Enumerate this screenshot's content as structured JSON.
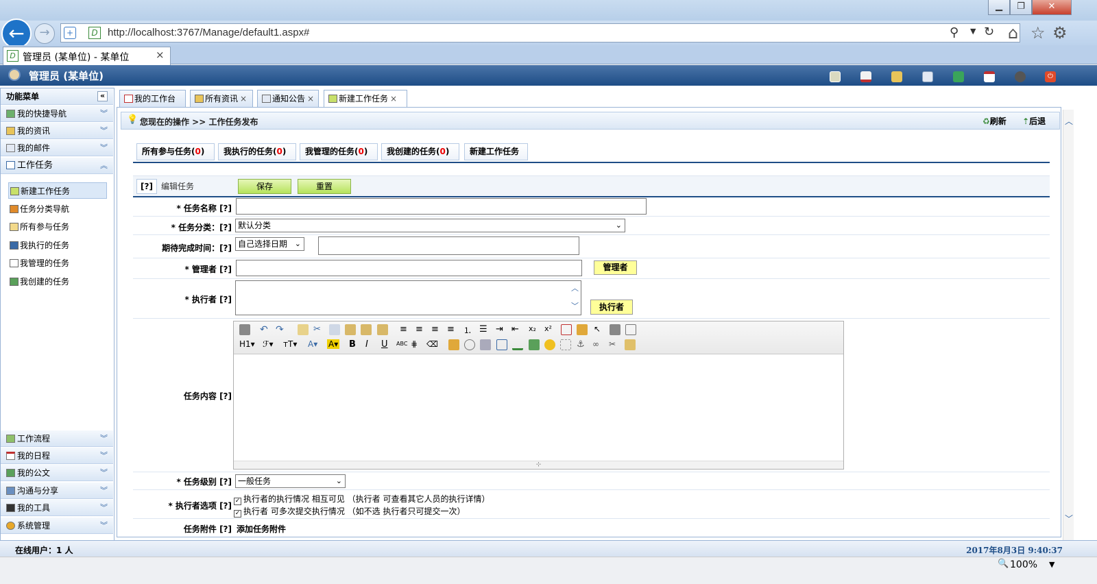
{
  "browser": {
    "url": "http://localhost:3767/Manage/default1.aspx#",
    "tab_title": "管理员 (某单位) - 某单位",
    "tab_close": "×",
    "zoom": "100%",
    "zoom_icon": "magnifier-icon"
  },
  "app": {
    "header_title": "管理员 (某单位)",
    "header_icons": [
      "edit-icon",
      "home-icon",
      "clipboard-icon",
      "mail-icon",
      "contacts-icon",
      "calendar-icon",
      "user-icon",
      "power-icon"
    ]
  },
  "sidebar": {
    "title": "功能菜单",
    "collapse": "«",
    "top_items": [
      {
        "label": "我的快捷导航"
      },
      {
        "label": "我的资讯"
      },
      {
        "label": "我的邮件"
      },
      {
        "label": "工作任务"
      }
    ],
    "sub_items": [
      {
        "label": "新建工作任务"
      },
      {
        "label": "任务分类导航"
      },
      {
        "label": "所有参与任务"
      },
      {
        "label": "我执行的任务"
      },
      {
        "label": "我管理的任务"
      },
      {
        "label": "我创建的任务"
      }
    ],
    "bottom_items": [
      {
        "label": "工作流程"
      },
      {
        "label": "我的日程"
      },
      {
        "label": "我的公文"
      },
      {
        "label": "沟通与分享"
      },
      {
        "label": "我的工具"
      },
      {
        "label": "系统管理"
      }
    ]
  },
  "content_tabs": [
    {
      "label": "我的工作台"
    },
    {
      "label": "所有资讯"
    },
    {
      "label": "通知公告"
    },
    {
      "label": "新建工作任务"
    }
  ],
  "tab_close": "×",
  "opbar": {
    "text": "您现在的操作 >> 工作任务发布",
    "refresh": "刷新",
    "back": "后退"
  },
  "subtabs": [
    {
      "label": "所有参与任务(",
      "count": "0",
      "end": ")"
    },
    {
      "label": "我执行的任务(",
      "count": "0",
      "end": ")"
    },
    {
      "label": "我管理的任务(",
      "count": "0",
      "end": ")"
    },
    {
      "label": "我创建的任务(",
      "count": "0",
      "end": ")"
    },
    {
      "label": "新建工作任务",
      "count": "",
      "end": ""
    }
  ],
  "form": {
    "help": "[?]",
    "edit_title": "编辑任务",
    "save": "保存",
    "reset": "重置",
    "name_label": "* 任务名称 [?]",
    "name_value": "",
    "category_label": "* 任务分类：[?]",
    "category_value": "默认分类",
    "deadline_label": "期待完成时间：[?]",
    "deadline_select": "自己选择日期",
    "deadline_value": "",
    "manager_label": "* 管理者 [?]",
    "manager_btn": "管理者",
    "executor_label": "* 执行者 [?]",
    "executor_btn": "执行者",
    "content_label": "任务内容 [?]",
    "level_label": "* 任务级别 [?]",
    "level_value": "一般任务",
    "options_label": "* 执行者选项 [?]",
    "option1": "执行者的执行情况 相互可见 （执行者 可查看其它人员的执行详情）",
    "option2": "执行者 可多次提交执行情况 （如不选 执行者只可提交一次）",
    "attach_label": "任务附件 [?]",
    "attach_link": "添加任务附件"
  },
  "editor_toolbar": {
    "row2_labels": [
      "H1",
      "ℱ",
      "тT",
      "A",
      "A",
      "B",
      "I",
      "U",
      "ABC"
    ]
  },
  "status": {
    "online": "在线用户：1 人",
    "datetime": "2017年8月3日 9:40:37"
  }
}
